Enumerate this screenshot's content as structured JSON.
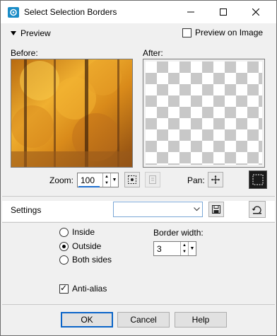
{
  "window": {
    "title": "Select Selection Borders",
    "minimize_icon": "minimize-icon",
    "maximize_icon": "maximize-icon",
    "close_icon": "close-icon"
  },
  "preview": {
    "toggle_label": "Preview",
    "preview_on_image_label": "Preview on Image",
    "preview_on_image_checked": false,
    "before_label": "Before:",
    "after_label": "After:"
  },
  "zoom": {
    "label": "Zoom:",
    "value": "100"
  },
  "pan": {
    "label": "Pan:"
  },
  "settings": {
    "label": "Settings",
    "preset_value": ""
  },
  "options": {
    "inside_label": "Inside",
    "outside_label": "Outside",
    "both_sides_label": "Both sides",
    "selected": "Outside",
    "border_width_label": "Border width:",
    "border_width_value": "3",
    "anti_alias_label": "Anti-alias",
    "anti_alias_checked": true
  },
  "buttons": {
    "ok": "OK",
    "cancel": "Cancel",
    "help": "Help"
  },
  "colors": {
    "accent": "#0a64c8",
    "dialog_bg": "#f0f0f0"
  }
}
